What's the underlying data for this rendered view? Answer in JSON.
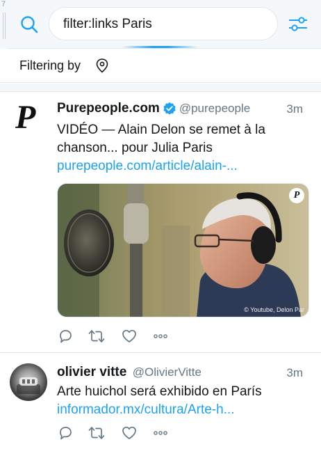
{
  "strip": {
    "number": "7"
  },
  "search": {
    "query": "filter:links Paris"
  },
  "filter": {
    "label": "Filtering by"
  },
  "tweets": [
    {
      "name": "Purepeople.com",
      "handle": "@purepeople",
      "time": "3m",
      "text": "VIDÉO — Alain Delon se remet à la chanson... pour Julia Paris",
      "link": "purepeople.com/article/alain-...",
      "media_credit": "© Youtube, Delon Par",
      "media_badge": "P",
      "logo_letter": "P"
    },
    {
      "name": "olivier vitte",
      "handle": "@OlivierVitte",
      "time": "3m",
      "text": "Arte huichol será exhibido en París",
      "link": "informador.mx/cultura/Arte-h..."
    }
  ],
  "icons": {
    "search": "search-icon",
    "filter": "sliders-icon",
    "location": "location-pin-icon",
    "verified": "verified-badge-icon",
    "reply": "reply-icon",
    "retweet": "retweet-icon",
    "like": "heart-icon",
    "more": "more-icon"
  },
  "colors": {
    "accent": "#1da1f2",
    "secondary_text": "#657786",
    "border": "#e1e8ed"
  }
}
